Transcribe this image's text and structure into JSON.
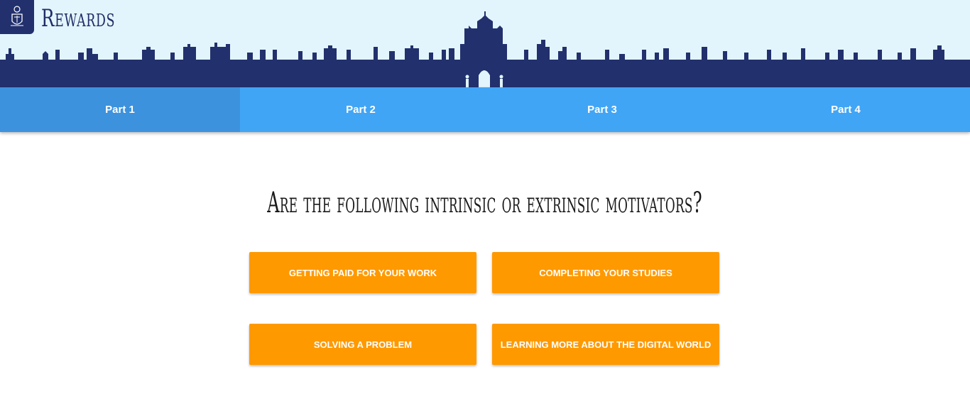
{
  "header": {
    "title": "Rewards",
    "logo_icon": "crest-icon",
    "background_color": "#e2f5fd",
    "skyline_color": "#22306d"
  },
  "tabs": [
    {
      "label": "Part 1",
      "active": true
    },
    {
      "label": "Part 2",
      "active": false
    },
    {
      "label": "Part 3",
      "active": false
    },
    {
      "label": "Part 4",
      "active": false
    }
  ],
  "colors": {
    "tab_bar": "#41a5f5",
    "tab_active": "#3c92dd",
    "answer_button": "#ff9900"
  },
  "main": {
    "question": "Are the following intrinsic or extrinsic motivators?",
    "answers": [
      {
        "label": "Getting paid for your work"
      },
      {
        "label": "Completing your studies"
      },
      {
        "label": "Solving a problem"
      },
      {
        "label": "Learning more about the digital world"
      }
    ]
  }
}
